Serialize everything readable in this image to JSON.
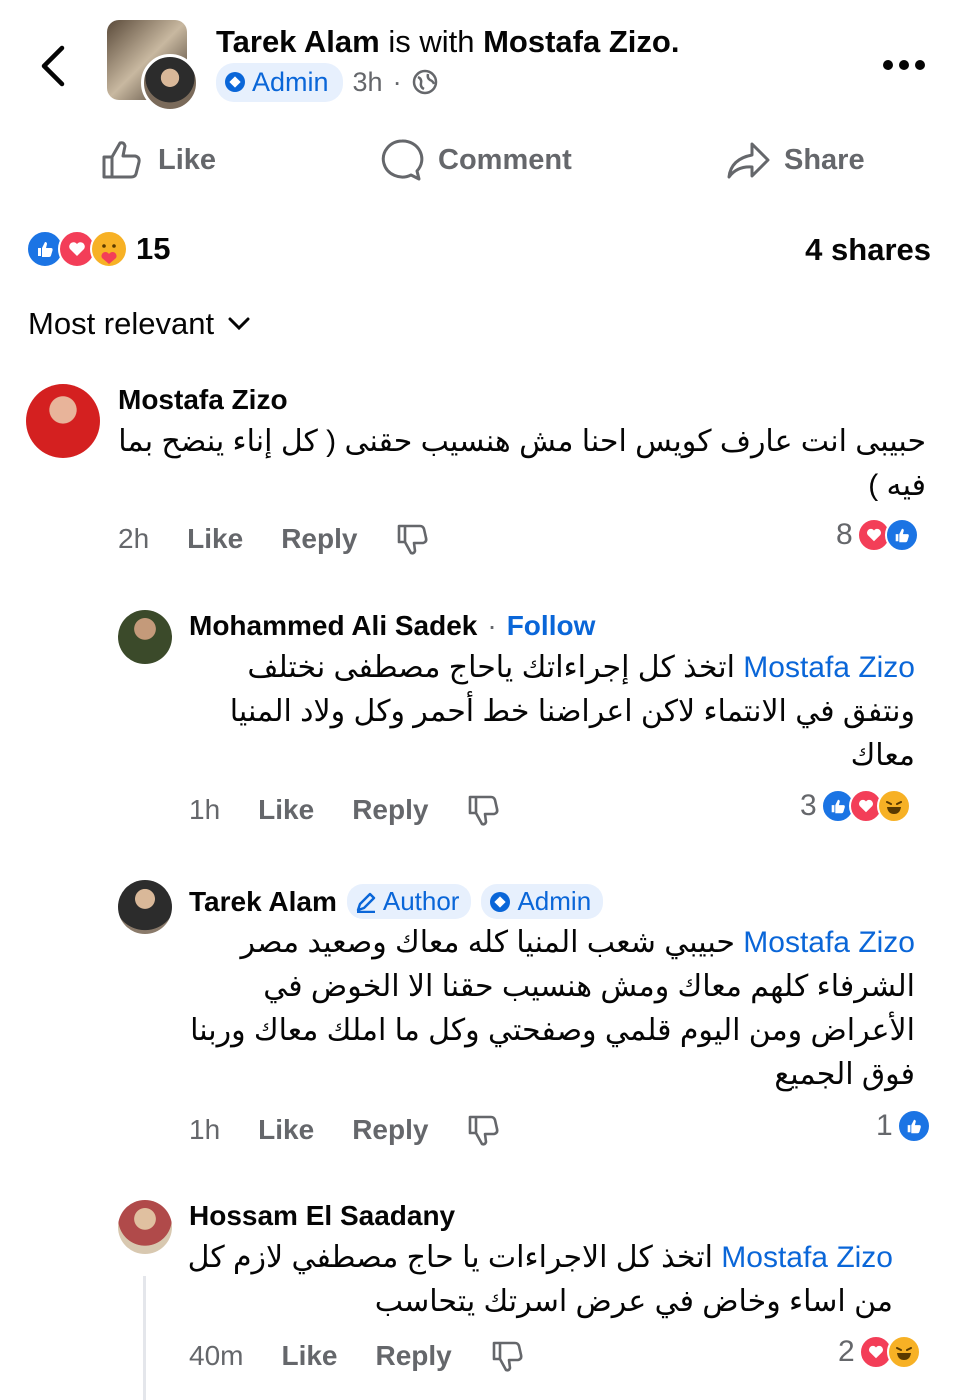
{
  "header": {
    "poster": "Tarek Alam",
    "with_text": "is with",
    "tagged": "Mostafa Zizo.",
    "badge": "Admin",
    "time": "3h",
    "separator": "·"
  },
  "actions": {
    "like": "Like",
    "comment": "Comment",
    "share": "Share"
  },
  "summary": {
    "reaction_count": "15",
    "shares": "4 shares"
  },
  "sort": {
    "label": "Most relevant"
  },
  "comments": [
    {
      "name": "Mostafa Zizo",
      "body": "حبيبى انت عارف كويس احنا مش هنسيب حقنى ( كل إناء ينضح بما فيه )",
      "time": "2h",
      "like": "Like",
      "reply": "Reply",
      "reactions": "8"
    },
    {
      "name": "Mohammed Ali Sadek",
      "dot": "·",
      "follow": "Follow",
      "mention": "Mostafa Zizo",
      "body": "اتخذ كل إجراءاتك ياحاج مصطفى نختلف ونتفق في الانتماء لاكن اعراضنا خط أحمر وكل ولاد المنيا معاك",
      "time": "1h",
      "like": "Like",
      "reply": "Reply",
      "reactions": "3"
    },
    {
      "name": "Tarek Alam",
      "tag_author": "Author",
      "tag_admin": "Admin",
      "mention": "Mostafa Zizo",
      "body": "حبيبي شعب المنيا كله معاك وصعيد مصر الشرفاء كلهم معاك ومش هنسيب حقنا الا الخوض في الأعراض ومن اليوم قلمي وصفحتي وكل ما املك معاك وربنا فوق الجميع",
      "time": "1h",
      "like": "Like",
      "reply": "Reply",
      "reactions": "1"
    },
    {
      "name": "Hossam El Saadany",
      "mention": "Mostafa Zizo",
      "body": "اتخذ كل الاجراءات يا حاج مصطفي لازم كل من اساء وخاض في عرض اسرتك يتحاسب",
      "time": "40m",
      "like": "Like",
      "reply": "Reply",
      "reactions": "2"
    }
  ],
  "colors": {
    "accent": "#0a66d8",
    "like": "#1b74e4",
    "love": "#f33e58",
    "haha": "#f7b125",
    "muted": "#65676b"
  },
  "icons": [
    "back-chevron-icon",
    "admin-diamond-icon",
    "globe-icon",
    "more-dots-icon",
    "thumbs-up-icon",
    "comment-bubble-icon",
    "share-arrow-icon",
    "dislike-icon",
    "pencil-icon"
  ]
}
